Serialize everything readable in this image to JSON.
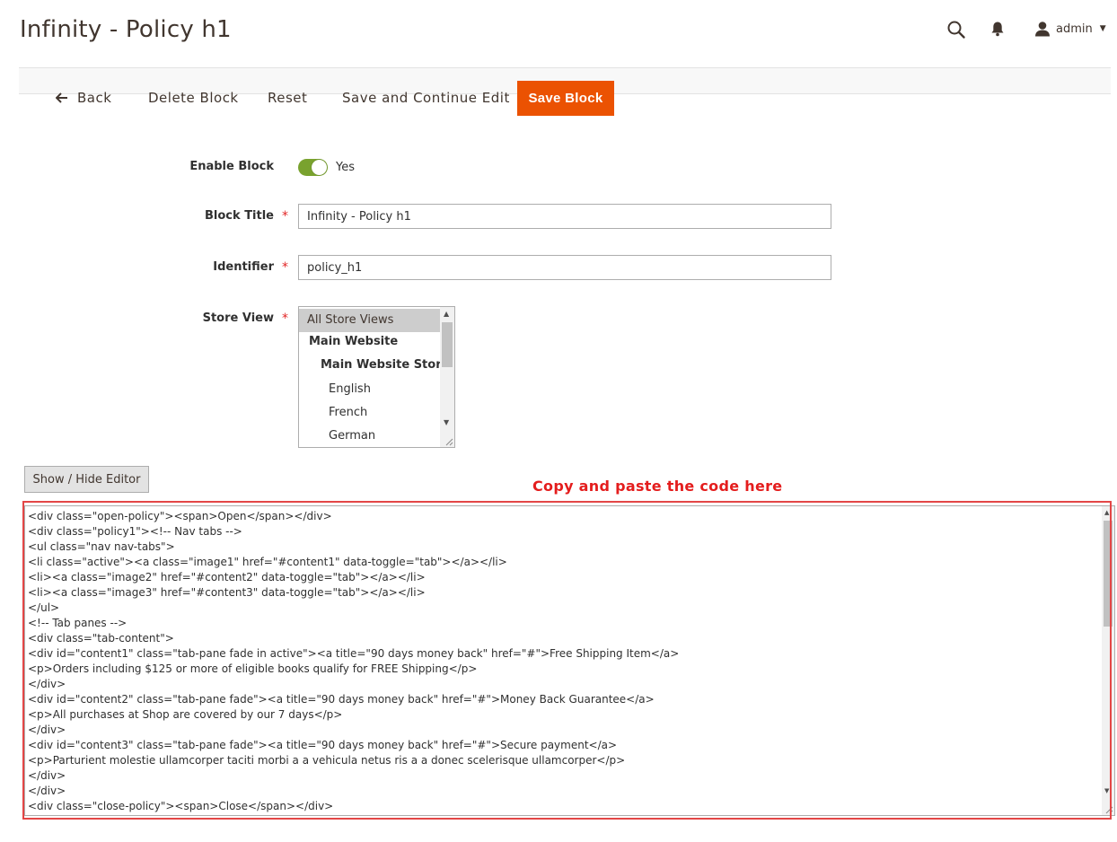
{
  "header": {
    "page_title": "Infinity - Policy h1",
    "user_name": "admin",
    "icons": [
      "search-icon",
      "bell-icon",
      "user-icon",
      "caret-down-icon"
    ]
  },
  "actions": {
    "back_label": "Back",
    "delete_label": "Delete Block",
    "reset_label": "Reset",
    "save_continue_label": "Save and Continue Edit",
    "save_label": "Save Block",
    "save_color": "#eb5202"
  },
  "form": {
    "enable": {
      "label": "Enable Block",
      "value_label": "Yes",
      "on": true,
      "color": "#79a22e"
    },
    "title": {
      "label": "Block Title",
      "required_mark": "*",
      "value": "Infinity - Policy h1"
    },
    "identifier": {
      "label": "Identifier",
      "required_mark": "*",
      "value": "policy_h1"
    },
    "store_view": {
      "label": "Store View",
      "required_mark": "*",
      "options": [
        {
          "label": "All Store Views",
          "selected": true
        },
        {
          "label": "Main Website",
          "bold": true
        },
        {
          "label": "Main Website Store",
          "bold": true
        },
        {
          "label": "English"
        },
        {
          "label": "French"
        },
        {
          "label": "German"
        }
      ]
    }
  },
  "editor": {
    "toggle_label": "Show / Hide Editor",
    "annotation": "Copy and paste the code here",
    "annotation_color": "#e41d1d",
    "lines": [
      "<div class=\"open-policy\"><span>Open</span></div>",
      "<div class=\"policy1\"><!-- Nav tabs -->",
      "<ul class=\"nav nav-tabs\">",
      "<li class=\"active\"><a class=\"image1\" href=\"#content1\" data-toggle=\"tab\"></a></li>",
      "<li><a class=\"image2\" href=\"#content2\" data-toggle=\"tab\"></a></li>",
      "<li><a class=\"image3\" href=\"#content3\" data-toggle=\"tab\"></a></li>",
      "</ul>",
      "<!-- Tab panes -->",
      "<div class=\"tab-content\">",
      "<div id=\"content1\" class=\"tab-pane fade in active\"><a title=\"90 days money back\" href=\"#\">Free Shipping Item</a>",
      "<p>Orders including $125 or more of eligible books qualify for FREE Shipping</p>",
      "</div>",
      "<div id=\"content2\" class=\"tab-pane fade\"><a title=\"90 days money back\" href=\"#\">Money Back Guarantee</a>",
      "<p>All purchases at Shop are covered by our 7 days</p>",
      "</div>",
      "<div id=\"content3\" class=\"tab-pane fade\"><a title=\"90 days money back\" href=\"#\">Secure payment</a>",
      "<p>Parturient molestie ullamcorper taciti morbi a a vehicula netus ris a a donec scelerisque ullamcorper</p>",
      "</div>",
      "</div>",
      "<div class=\"close-policy\"><span>Close</span></div>"
    ]
  }
}
